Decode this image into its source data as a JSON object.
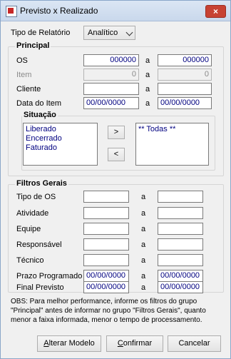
{
  "window": {
    "title": "Previsto x Realizado",
    "close_icon": "×"
  },
  "tipo_relatorio": {
    "label": "Tipo de Relatório",
    "value": "Analítico"
  },
  "principal": {
    "title": "Principal",
    "os": {
      "label": "OS",
      "from": "000000",
      "sep": "a",
      "to": "000000"
    },
    "item": {
      "label": "Item",
      "from": "0",
      "sep": "a",
      "to": "0"
    },
    "cliente": {
      "label": "Cliente",
      "from": "",
      "sep": "a",
      "to": ""
    },
    "data_item": {
      "label": "Data do Item",
      "from": "00/00/0000",
      "sep": "a",
      "to": "00/00/0000"
    },
    "situacao": {
      "title": "Situação",
      "available": [
        "Liberado",
        "Encerrado",
        "Faturado"
      ],
      "add_label": ">",
      "remove_label": "<",
      "selected": [
        "** Todas **"
      ]
    }
  },
  "filtros": {
    "title": "Filtros Gerais",
    "rows": [
      {
        "label": "Tipo de OS",
        "from": "",
        "sep": "a",
        "to": ""
      },
      {
        "label": "Atividade",
        "from": "",
        "sep": "a",
        "to": ""
      },
      {
        "label": "Equipe",
        "from": "",
        "sep": "a",
        "to": ""
      },
      {
        "label": "Responsável",
        "from": "",
        "sep": "a",
        "to": ""
      },
      {
        "label": "Técnico",
        "from": "",
        "sep": "a",
        "to": ""
      },
      {
        "label": "Prazo Programado",
        "from": "00/00/0000",
        "sep": "a",
        "to": "00/00/0000"
      },
      {
        "label": "Final Previsto",
        "from": "00/00/0000",
        "sep": "a",
        "to": "00/00/0000"
      }
    ]
  },
  "obs": "OBS: Para melhor performance, informe os filtros do grupo \"Principal\" antes de informar no grupo \"Filtros Gerais\", quanto menor a faixa informada, menor o tempo de processamento.",
  "buttons": {
    "alterar_accel": "A",
    "alterar_rest": "lterar Modelo",
    "confirmar_accel": "C",
    "confirmar_rest": "onfirmar",
    "cancelar": "Cancelar"
  }
}
